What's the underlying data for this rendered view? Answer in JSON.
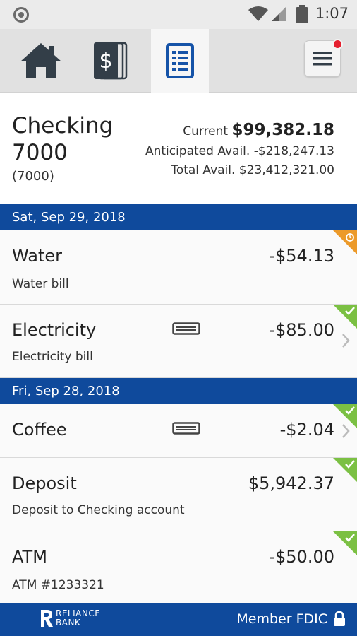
{
  "status_bar": {
    "time": "1:07"
  },
  "tabs": [
    {
      "name": "home",
      "icon": "home-icon"
    },
    {
      "name": "accounts",
      "icon": "dollar-icon"
    },
    {
      "name": "activity",
      "icon": "document-list-icon"
    }
  ],
  "account": {
    "name": "Checking 7000",
    "number": "(7000)",
    "current_label": "Current",
    "current_value": "$99,382.18",
    "anticipated_label": "Anticipated Avail.",
    "anticipated_value": "-$218,247.13",
    "total_label": "Total Avail.",
    "total_value": "$23,412,321.00"
  },
  "groups": [
    {
      "date": "Sat, Sep 29, 2018",
      "transactions": [
        {
          "title": "Water",
          "amount": "-$54.13",
          "description": "Water bill",
          "status": "pending"
        },
        {
          "title": "Electricity",
          "amount": "-$85.00",
          "description": "Electricity bill",
          "status": "cleared"
        }
      ]
    },
    {
      "date": "Fri, Sep 28, 2018",
      "transactions": [
        {
          "title": "Coffee",
          "amount": "-$2.04",
          "description": "",
          "status": "cleared"
        },
        {
          "title": "Deposit",
          "amount": "$5,942.37",
          "description": "Deposit to Checking account",
          "status": "cleared"
        },
        {
          "title": "ATM",
          "amount": "-$50.00",
          "description": "ATM #1233321",
          "status": "cleared"
        }
      ]
    }
  ],
  "footer": {
    "logo_line1": "RELIANCE",
    "logo_line2": "BANK",
    "fdic": "Member FDIC"
  },
  "colors": {
    "brand_blue": "#0f4a9c",
    "cleared_green": "#7bc043",
    "pending_orange": "#ec9a2a",
    "notification_red": "#e5202f"
  }
}
